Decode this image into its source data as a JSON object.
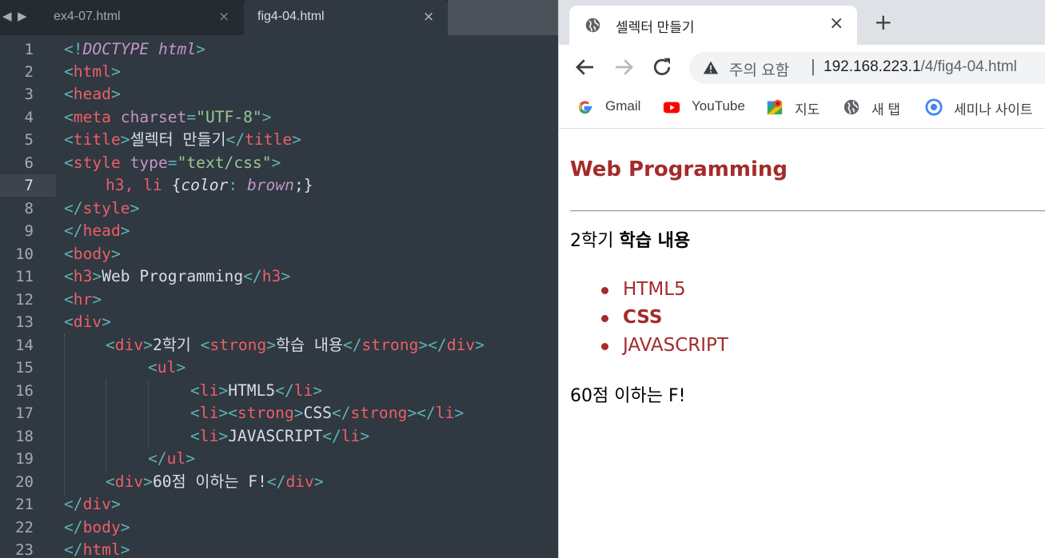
{
  "editor": {
    "tabs": [
      {
        "label": "ex4-07.html",
        "active": false
      },
      {
        "label": "fig4-04.html",
        "active": true
      }
    ],
    "close_glyph": "×",
    "line_numbers": [
      "1",
      "2",
      "3",
      "4",
      "5",
      "6",
      "7",
      "8",
      "9",
      "10",
      "11",
      "12",
      "13",
      "14",
      "15",
      "16",
      "17",
      "18",
      "19",
      "20",
      "21",
      "22",
      "23"
    ],
    "current_line": "7",
    "code": {
      "l1": {
        "a": "<!",
        "b": "DOCTYPE html",
        "c": ">"
      },
      "l2": {
        "a": "<",
        "b": "html",
        "c": ">"
      },
      "l3": {
        "a": "<",
        "b": "head",
        "c": ">"
      },
      "l4": {
        "a": "<",
        "b": "meta",
        "c": " charset",
        "d": "=",
        "e": "\"UTF-8\"",
        "f": ">"
      },
      "l5": {
        "a": "<",
        "b": "title",
        "c": ">",
        "d": "셀렉터 만들기",
        "e": "</",
        "f": "title",
        "g": ">"
      },
      "l6": {
        "a": "<",
        "b": "style",
        "c": " type",
        "d": "=",
        "e": "\"text/css\"",
        "f": ">"
      },
      "l7": {
        "a": "h3, li",
        "b": " {",
        "c": "color",
        "d": ": ",
        "e": "brown",
        "f": ";}"
      },
      "l8": {
        "a": "</",
        "b": "style",
        "c": ">"
      },
      "l9": {
        "a": "</",
        "b": "head",
        "c": ">"
      },
      "l10": {
        "a": "<",
        "b": "body",
        "c": ">"
      },
      "l11": {
        "a": "<",
        "b": "h3",
        "c": ">",
        "d": "Web Programming",
        "e": "</",
        "f": "h3",
        "g": ">"
      },
      "l12": {
        "a": "<",
        "b": "hr",
        "c": ">"
      },
      "l13": {
        "a": "<",
        "b": "div",
        "c": ">"
      },
      "l14": {
        "a": "<",
        "b": "div",
        "c": ">",
        "d": "2학기 ",
        "e": "<",
        "f": "strong",
        "g": ">",
        "h": "학습 내용",
        "i": "</",
        "j": "strong",
        "k": "></",
        "l": "div",
        "m": ">"
      },
      "l15": {
        "a": "<",
        "b": "ul",
        "c": ">"
      },
      "l16": {
        "a": "<",
        "b": "li",
        "c": ">",
        "d": "HTML5",
        "e": "</",
        "f": "li",
        "g": ">"
      },
      "l17": {
        "a": "<",
        "b": "li",
        "c": "><",
        "d": "strong",
        "e": ">",
        "f": "CSS",
        "g": "</",
        "h": "strong",
        "i": "></",
        "j": "li",
        "k": ">"
      },
      "l18": {
        "a": "<",
        "b": "li",
        "c": ">",
        "d": "JAVASCRIPT",
        "e": "</",
        "f": "li",
        "g": ">"
      },
      "l19": {
        "a": "</",
        "b": "ul",
        "c": ">"
      },
      "l20": {
        "a": "<",
        "b": "div",
        "c": ">",
        "d": "60점 이하는 F!",
        "e": "</",
        "f": "div",
        "g": ">"
      },
      "l21": {
        "a": "</",
        "b": "div",
        "c": ">"
      },
      "l22": {
        "a": "</",
        "b": "body",
        "c": ">"
      },
      "l23": {
        "a": "</",
        "b": "html",
        "c": ">"
      }
    }
  },
  "browser": {
    "tab_title": "셀렉터 만들기",
    "tab_close": "×",
    "new_tab": "+",
    "address": {
      "security_label": "주의 요함",
      "separator": "|",
      "host": "192.168.223.1",
      "path": "/4/fig4-04.html"
    },
    "bookmarks": [
      {
        "label": "Gmail",
        "icon": "google-icon"
      },
      {
        "label": "YouTube",
        "icon": "youtube-icon"
      },
      {
        "label": "지도",
        "icon": "maps-icon"
      },
      {
        "label": "새 탭",
        "icon": "globe-icon"
      },
      {
        "label": "세미나 사이트",
        "icon": "chrome-icon"
      }
    ],
    "page": {
      "heading": "Web Programming",
      "intro_plain": "2학기 ",
      "intro_strong": "학습 내용",
      "list": [
        "HTML5",
        "CSS",
        "JAVASCRIPT"
      ],
      "footer": "60점 이하는 F!"
    },
    "colors": {
      "brown": "#a52a2a"
    }
  }
}
